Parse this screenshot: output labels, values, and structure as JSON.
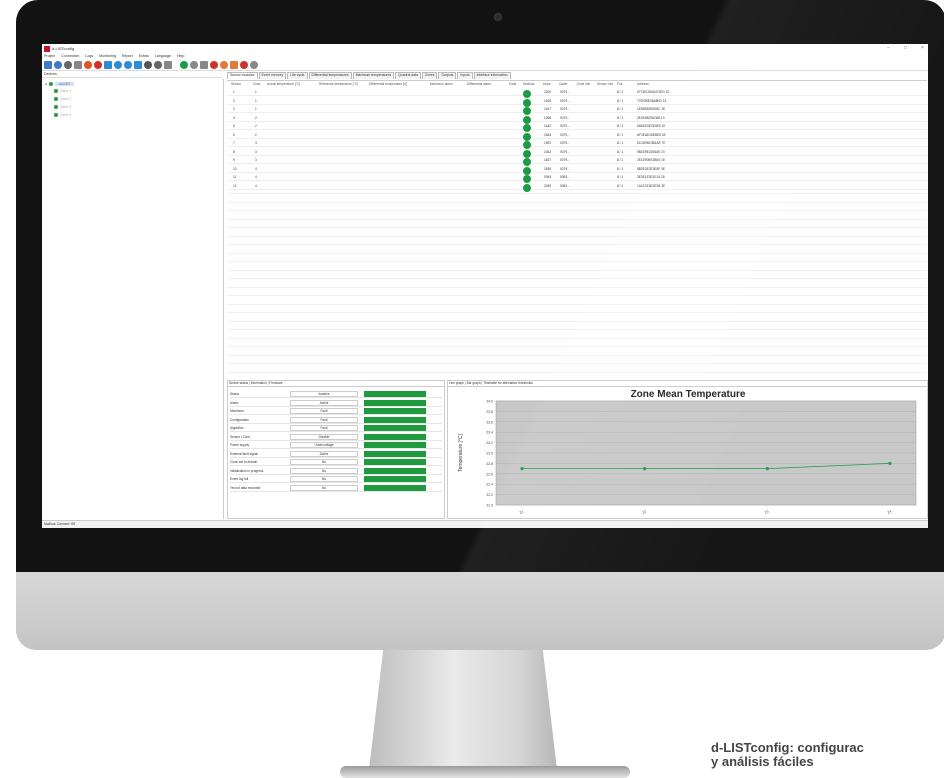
{
  "window": {
    "title": "d-LISTconfig",
    "controls": [
      "−",
      "□",
      "×"
    ]
  },
  "menu": [
    "Project",
    "Connection",
    "Logs",
    "Monitoring",
    "Report",
    "Extras",
    "Language",
    "Help"
  ],
  "toolbar_icons": [
    {
      "name": "new-icon",
      "color": "#3d7cc9"
    },
    {
      "name": "save-icon",
      "color": "#3d7cc9"
    },
    {
      "name": "print-icon",
      "color": "#666666"
    },
    {
      "name": "tools-icon",
      "color": "#888888"
    },
    {
      "name": "clock-icon",
      "color": "#e0551e"
    },
    {
      "name": "stop-icon",
      "color": "#d0312d"
    },
    {
      "name": "connect-icon",
      "color": "#2e8bd6"
    },
    {
      "name": "list-icon",
      "color": "#2e8bd6"
    },
    {
      "name": "monitor-icon",
      "color": "#2e8bd6"
    },
    {
      "name": "info-icon",
      "color": "#2e8bd6"
    },
    {
      "name": "report-icon",
      "color": "#555555"
    },
    {
      "name": "settings-icon",
      "color": "#666666"
    },
    {
      "name": "download-icon",
      "color": "#888888"
    },
    {
      "name": "start-icon",
      "color": "#1c9b45"
    },
    {
      "name": "zoom-icon",
      "color": "#888888"
    },
    {
      "name": "graph-icon",
      "color": "#888888"
    },
    {
      "name": "alarm-icon",
      "color": "#d0312d"
    },
    {
      "name": "warning-icon",
      "color": "#e07b39"
    },
    {
      "name": "fault-icon",
      "color": "#e07b39"
    },
    {
      "name": "error-icon",
      "color": "#d0312d"
    },
    {
      "name": "lock-icon",
      "color": "#888888"
    }
  ],
  "devices_label": "Devices",
  "tree": {
    "root": "d-LIST",
    "children": [
      "Zone 1",
      "Zone 2",
      "Zone 3",
      "Zone 4"
    ]
  },
  "top_tabs": [
    "Sensor modules",
    "Event memory",
    "Life cycle",
    "Differential temperatures",
    "Maximum temperatures",
    "Quadrat data",
    "Zones",
    "Outputs",
    "Inputs",
    "Interface information"
  ],
  "sensor_table": {
    "columns": [
      "Sensor",
      "Zone",
      "Actual temperature [°C]",
      "Reference temperature [°C]",
      "Differential temperature [K]",
      "Maximum alarm",
      "Differential alarm",
      "Fault",
      "Modbus",
      "Hops",
      "Cable",
      "Zone info",
      "Sensor info",
      "Pos.",
      "Address"
    ],
    "rows": [
      {
        "sensor": "1",
        "zone": "1",
        "hops": "2200",
        "cable": "0079...",
        "pos": "8 / 1",
        "address": "0774ECBDA472ED 10"
      },
      {
        "sensor": "2",
        "zone": "1",
        "hops": "1208",
        "cable": "0079...",
        "pos": "8 / 1",
        "address": "770F89E35A8ED 13"
      },
      {
        "sensor": "3",
        "zone": "1",
        "hops": "1447",
        "cable": "0079...",
        "pos": "8 / 1",
        "address": "1E83B52E6D8C 1E"
      },
      {
        "sensor": "4",
        "zone": "2",
        "hops": "1068",
        "cable": "0079...",
        "pos": "8 / 1",
        "address": "2E2E6829DD68 10"
      },
      {
        "sensor": "5",
        "zone": "2",
        "hops": "1442",
        "cable": "0079...",
        "pos": "8 / 1",
        "address": "5A51EDE2E0E5 10"
      },
      {
        "sensor": "6",
        "zone": "2",
        "hops": "1844",
        "cable": "0079...",
        "pos": "8 / 1",
        "address": "AF2EAE26EBE5 3E"
      },
      {
        "sensor": "7",
        "zone": "3",
        "hops": "1902",
        "cable": "0079...",
        "pos": "8 / 1",
        "address": "5C2D9B23B1AE 7E"
      },
      {
        "sensor": "8",
        "zone": "3",
        "hops": "1042",
        "cable": "0079...",
        "pos": "8 / 1",
        "address": "9B1E9E22E6AE 20"
      },
      {
        "sensor": "9",
        "zone": "3",
        "hops": "1637",
        "cable": "0079...",
        "pos": "8 / 1",
        "address": "2E1E90EE3BE6 1E"
      },
      {
        "sensor": "10",
        "zone": "4",
        "hops": "1839",
        "cable": "0079...",
        "pos": "8 / 1",
        "address": "8B2E3E2E3E8F 3E"
      },
      {
        "sensor": "11",
        "zone": "4",
        "hops": "0945",
        "cable": "0053...",
        "pos": "8 / 1",
        "address": "3E2E1E3E1E1A 28"
      },
      {
        "sensor": "12",
        "zone": "4",
        "hops": "2049",
        "cable": "0053...",
        "pos": "8 / 1",
        "address": "1A1E2E3E2E2B 3E"
      }
    ]
  },
  "status_panel": {
    "tabs": "Device status | Information | Firmware",
    "rows": [
      {
        "label": "Status",
        "value": "Inactive",
        "color": "#1f9a3f"
      },
      {
        "label": "Alarm",
        "value": "Active",
        "color": "#1f9a3f"
      },
      {
        "label": "Maximum",
        "value": "Fault",
        "color": "#1f9a3f"
      },
      {
        "label": "Configuration",
        "value": "Fault",
        "color": "#1f9a3f"
      },
      {
        "label": "Algorithm",
        "value": "Fault",
        "color": "#1f9a3f"
      },
      {
        "label": "Sensor / Zone",
        "value": "Disable",
        "color": "#1f9a3f"
      },
      {
        "label": "Power supply",
        "value": "Undervoltage",
        "color": "#1f9a3f"
      },
      {
        "label": "External fault signal",
        "value": "Active",
        "color": "#1f9a3f"
      },
      {
        "label": "Clock set to default",
        "value": "No",
        "color": "#1f9a3f"
      },
      {
        "label": "Initialization in progress",
        "value": "No",
        "color": "#1f9a3f"
      },
      {
        "label": "Event log full",
        "value": "No",
        "color": "#1f9a3f"
      },
      {
        "label": "Yet not data recorded",
        "value": "No",
        "color": "#1f9a3f"
      }
    ]
  },
  "chart_panel": {
    "tabs": "Line graph | Bar graph | Timetable for alternative thresholds"
  },
  "chart_data": {
    "type": "line",
    "title": "Zone Mean Temperature",
    "xlabel": "Zones",
    "ylabel": "Temperature [°C]",
    "categories": [
      "Z1",
      "Z2",
      "Z3",
      "Z4"
    ],
    "series": [
      {
        "values": [
          22.7,
          22.7,
          22.7,
          22.8
        ],
        "color": "#1c9b45"
      }
    ],
    "yticks": [
      "24.0",
      "23.8",
      "23.6",
      "23.4",
      "23.2",
      "23.0",
      "22.8",
      "22.6",
      "22.4",
      "22.2",
      "22.0"
    ],
    "ylim": [
      22.0,
      24.0
    ],
    "grid": true,
    "plot_background": "#c8c8c8"
  },
  "statusbar": "Modbus: Connect: Off",
  "caption": {
    "line1": "d-LISTconfig: configurac",
    "line2": "y análisis fáciles"
  }
}
